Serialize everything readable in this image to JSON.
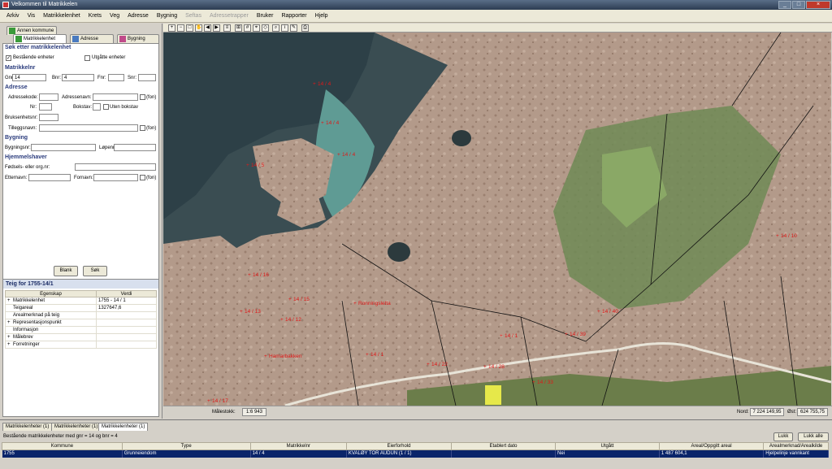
{
  "window": {
    "title": "Velkommen til Matrikkelen"
  },
  "menu": [
    "Arkiv",
    "Vis",
    "Matrikkelenhet",
    "Krets",
    "Veg",
    "Adresse",
    "Bygning",
    "Seftas",
    "Adressetrapper",
    "Bruker",
    "Rapporter",
    "Hjelp"
  ],
  "menu_disabled": [
    "Seftas",
    "Adressetrapper"
  ],
  "left": {
    "tabs": {
      "annen": "Annen kommune",
      "matrikkelenhet": "Matrikkelenhet",
      "adresse": "Adresse",
      "bygning": "Bygning"
    },
    "search_title": "Søk etter matrikkelenhet",
    "bestaaende": "Bestående enheter",
    "utgaatte": "Utgåtte enheter",
    "matrikkelnr": {
      "title": "Matrikkelnr",
      "gnr_label": "Gnr:",
      "gnr": "14",
      "bnr_label": "Bnr:",
      "bnr": "4",
      "fnr_label": "Fnr:",
      "snr_label": "Snr:"
    },
    "adresse": {
      "title": "Adresse",
      "adressekode": "Adressekode:",
      "adressenavn": "Adressenavn:",
      "fon": "(fon)",
      "nr": "Nr:",
      "bokstav": "Bokstav:",
      "uten_bokstav": "Uten bokstav",
      "bruksenhetsnr": "Bruksenhetsnr:",
      "tilleggsnavn": "Tilleggsnavn:"
    },
    "bygning": {
      "title": "Bygning",
      "bygningsnr": "Bygningsnr:",
      "lopenr": "Løpenr:"
    },
    "hjemmelshaver": {
      "title": "Hjemmelshaver",
      "fodsels": "Fødsels- eller org.nr:",
      "etternavn": "Etternavn:",
      "fornavn": "Fornavn:",
      "fon": "(fon)"
    },
    "blank_button": "Blank",
    "sok_button": "Søk",
    "teig": {
      "title": "Teig for 1755-14/1",
      "col_egenskap": "Egenskap",
      "col_verdi": "Verdi",
      "rows": [
        {
          "key": "Matrikkelenhet",
          "val": "1755 - 14 / 1",
          "exp": "+"
        },
        {
          "key": "Teigareal",
          "val": "1327647,6",
          "exp": ""
        },
        {
          "key": "Arealmerknad på teig",
          "val": "",
          "exp": ""
        },
        {
          "key": "Representasjonspunkt",
          "val": "",
          "exp": "+"
        },
        {
          "key": "Informasjon",
          "val": "",
          "exp": ""
        },
        {
          "key": "Målebrev",
          "val": "",
          "exp": "+"
        },
        {
          "key": "Forretninger",
          "val": "",
          "exp": "+"
        }
      ]
    }
  },
  "map": {
    "labels": [
      "14 / 4",
      "14 / 4",
      "14 / 4",
      "14 / 5",
      "14 / 1",
      "14 / 1",
      "14 / 22",
      "14 / 28",
      "14 / 33",
      "14 / 40",
      "14 / 39",
      "14 / 10",
      "14 / 17",
      "14 / 16",
      "14 / 15",
      "14 / 13",
      "14 / 12",
      "Ronningsletta",
      "Hamarbakken"
    ],
    "malestokk_label": "Målestokk:",
    "malestokk": "1:6 943",
    "nord_label": "Nord:",
    "nord": "7 224 149,95",
    "ost_label": "Øst:",
    "ost": "624 755,75"
  },
  "bottom": {
    "tabs": [
      "Matrikkelenheter (1)",
      "Matrikkelenheter (1)",
      "Matrikkelenheter (1)"
    ],
    "info": "Bestående matrikkelenheter med gnr = 14 og  bnr = 4",
    "lukk": "Lukk",
    "lukk_alle": "Lukk alle",
    "columns": [
      "Kommune",
      "Type",
      "Matrikkelnr",
      "Eierforhold",
      "Etablert dato",
      "Utgått",
      "Areal/Oppgitt areal",
      "Arealmerknad/Arealkilde"
    ],
    "row": [
      "1755",
      "Grunneiendom",
      "14 / 4",
      "KVALØY TOR AUDUN (1 / 1)",
      "",
      "Nei",
      "1 487 604,1",
      "Hjelpelinje vannkant"
    ]
  },
  "colors": {
    "accent": "#0a246a",
    "parcel_label": "#e01818"
  }
}
